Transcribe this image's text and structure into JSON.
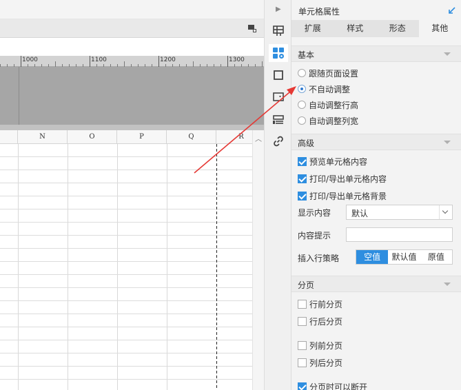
{
  "designer": {
    "ruler_labels": [
      "1000",
      "1100",
      "1200",
      "1300"
    ],
    "columns": [
      "N",
      "O",
      "P",
      "Q",
      "R"
    ]
  },
  "icon_strip": {
    "items": [
      "extend-icon",
      "cell-attribute-icon",
      "border-icon",
      "widget-icon",
      "condition-icon",
      "hyperlink-icon"
    ]
  },
  "panel": {
    "title": "单元格属性",
    "tabs": [
      {
        "label": "扩展"
      },
      {
        "label": "样式"
      },
      {
        "label": "形态"
      },
      {
        "label": "其他"
      }
    ],
    "active_tab": "其他",
    "basic": {
      "title": "基本",
      "options": [
        {
          "label": "跟随页面设置",
          "checked": false
        },
        {
          "label": "不自动调整",
          "checked": true
        },
        {
          "label": "自动调整行高",
          "checked": false
        },
        {
          "label": "自动调整列宽",
          "checked": false
        }
      ]
    },
    "advanced": {
      "title": "高级",
      "checks": [
        {
          "label": "预览单元格内容",
          "checked": true
        },
        {
          "label": "打印/导出单元格内容",
          "checked": true
        },
        {
          "label": "打印/导出单元格背景",
          "checked": true
        }
      ],
      "display_label": "显示内容",
      "display_value": "默认",
      "hint_label": "内容提示",
      "hint_value": "",
      "insert_label": "插入行策略",
      "insert_options": [
        "空值",
        "默认值",
        "原值"
      ],
      "insert_selected": "空值"
    },
    "paging": {
      "title": "分页",
      "checks": [
        {
          "label": "行前分页",
          "checked": false
        },
        {
          "label": "行后分页",
          "checked": false
        },
        {
          "label": "列前分页",
          "checked": false
        },
        {
          "label": "列后分页",
          "checked": false
        },
        {
          "label": "分页时可以断开",
          "checked": true
        }
      ]
    }
  },
  "colors": {
    "accent": "#2e8ee0",
    "annotation_arrow": "#e53935"
  }
}
